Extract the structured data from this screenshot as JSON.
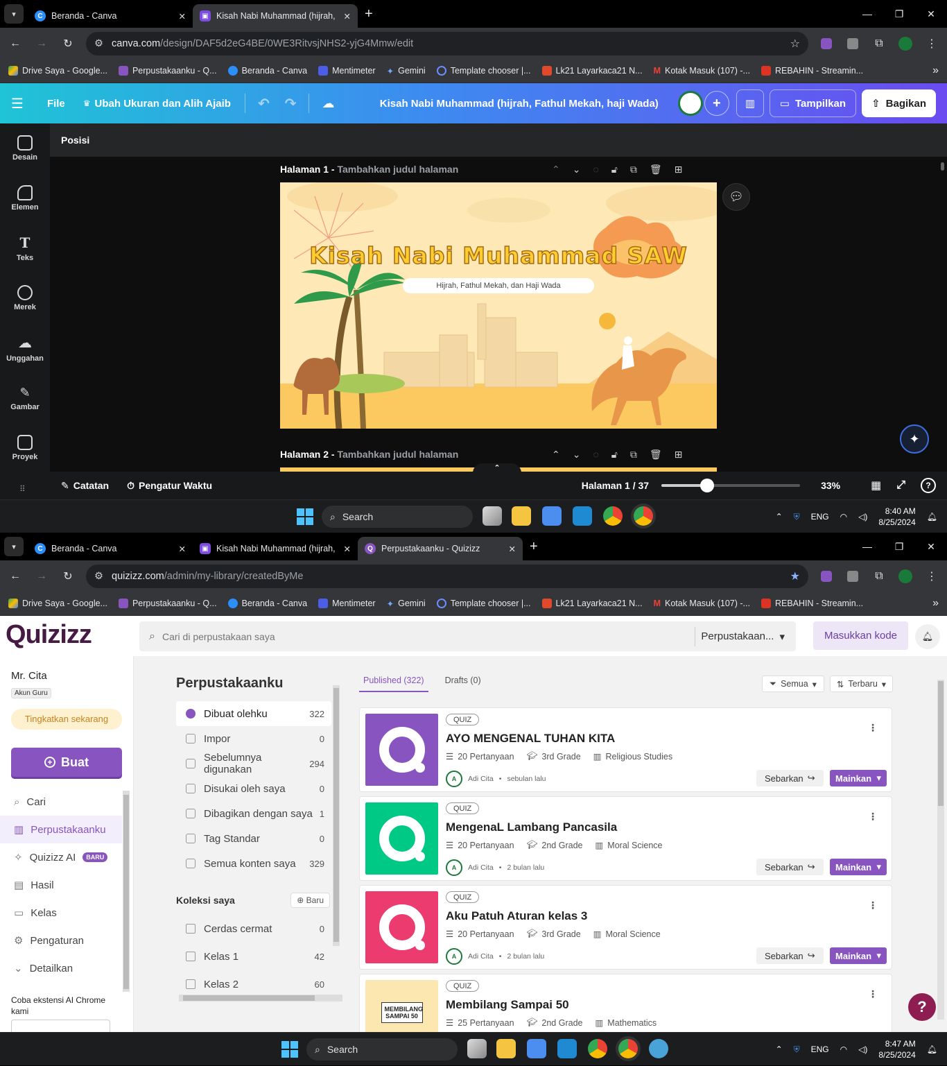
{
  "top": {
    "tabs": [
      {
        "title": "Beranda - Canva",
        "favicon": "canva-icon",
        "color": "#2c8ef8"
      },
      {
        "title": "Kisah Nabi Muhammad (hijrah,",
        "favicon": "canva-doc-icon",
        "color": "#7d4ce0"
      }
    ],
    "url_domain": "canva.com",
    "url_path": "/design/DAF5d2eG4BE/0WE3RitvsjNHS2-yjG4Mmw/edit",
    "bookmarks": [
      "Drive Saya - Google...",
      "Perpustakaanku - Q...",
      "Beranda - Canva",
      "Mentimeter",
      "Gemini",
      "Template chooser |...",
      "Lk21 Layarkaca21 N...",
      "Kotak Masuk (107) -...",
      "REBAHIN - Streamin..."
    ]
  },
  "canva": {
    "menu_file": "File",
    "menu_resize": "Ubah Ukuran dan Alih Ajaib",
    "doc_title": "Kisah Nabi Muhammad (hijrah, Fathul Mekah, haji Wada)",
    "btn_present": "Tampilkan",
    "btn_share": "Bagikan",
    "sidebar": [
      "Desain",
      "Elemen",
      "Teks",
      "Merek",
      "Unggahan",
      "Gambar",
      "Proyek"
    ],
    "position_label": "Posisi",
    "page1_label": "Halaman 1 -",
    "page1_sub": "Tambahkan judul halaman",
    "page2_label": "Halaman 2 -",
    "page2_sub": "Tambahkan judul halaman",
    "slide_title": "Kisah Nabi Muhammad SAW",
    "slide_subtitle": "Hijrah, Fathul Mekah, dan Haji Wada",
    "notes": "Catatan",
    "timer": "Pengatur Waktu",
    "page_count": "Halaman 1 / 37",
    "zoom": "33%",
    "zoom_level": 0.33
  },
  "taskbar1": {
    "search": "Search",
    "lang": "ENG",
    "time": "8:40 AM",
    "date": "8/25/2024"
  },
  "bottom": {
    "tabs": [
      {
        "title": "Beranda - Canva"
      },
      {
        "title": "Kisah Nabi Muhammad (hijrah,"
      },
      {
        "title": "Perpustakaanku - Quizizz"
      }
    ],
    "url_domain": "quizizz.com",
    "url_path": "/admin/my-library/createdByMe"
  },
  "quizizz": {
    "logo": "Quizizz",
    "search_placeholder": "Cari di perpustakaan saya",
    "scope": "Perpustakaan...",
    "enter_code": "Masukkan kode",
    "user_name": "Mr. Cita",
    "user_role": "Akun Guru",
    "upgrade": "Tingkatkan sekarang",
    "create": "Buat",
    "nav": [
      "Cari",
      "Perpustakaanku",
      "Quizizz AI",
      "Hasil",
      "Kelas",
      "Pengaturan",
      "Detailkan"
    ],
    "ai_badge": "BARU",
    "chrome_ext": "Coba ekstensi AI Chrome kami",
    "library_title": "Perpustakaanku",
    "library_nav": [
      {
        "label": "Dibuat olehku",
        "count": "322"
      },
      {
        "label": "Impor",
        "count": "0"
      },
      {
        "label": "Sebelumnya digunakan",
        "count": "294"
      },
      {
        "label": "Disukai oleh saya",
        "count": "0"
      },
      {
        "label": "Dibagikan dengan saya",
        "count": "1"
      },
      {
        "label": "Tag Standar",
        "count": "0"
      },
      {
        "label": "Semua konten saya",
        "count": "329"
      }
    ],
    "collections_title": "Koleksi saya",
    "new_collection": "Baru",
    "collections": [
      {
        "label": "Cerdas cermat",
        "count": "0"
      },
      {
        "label": "Kelas 1",
        "count": "42"
      },
      {
        "label": "Kelas 2",
        "count": "60"
      }
    ],
    "tab_published": "Published (322)",
    "tab_drafts": "Drafts (0)",
    "filter_all": "Semua",
    "sort_latest": "Terbaru",
    "share_label": "Sebarkan",
    "play_label": "Mainkan",
    "badge": "QUIZ",
    "quizzes": [
      {
        "title": "AYO MENGENAL TUHAN KITA",
        "questions": "20 Pertanyaan",
        "grade": "3rd Grade",
        "subject": "Religious Studies",
        "author": "Adi Cita",
        "when": "sebulan lalu",
        "color": "#8854c0"
      },
      {
        "title": "MengenaL Lambang Pancasila",
        "questions": "20 Pertanyaan",
        "grade": "2nd Grade",
        "subject": "Moral Science",
        "author": "Adi Cita",
        "when": "2 bulan lalu",
        "color": "#00c985"
      },
      {
        "title": "Aku Patuh Aturan kelas 3",
        "questions": "20 Pertanyaan",
        "grade": "3rd Grade",
        "subject": "Moral Science",
        "author": "Adi Cita",
        "when": "2 bulan lalu",
        "color": "#ec3b6e"
      },
      {
        "title": "Membilang Sampai 50",
        "questions": "25 Pertanyaan",
        "grade": "2nd Grade",
        "subject": "Mathematics",
        "author": "",
        "when": "",
        "color": "#fde7b0",
        "thumb_text": "MEMBILANG SAMPAI 50"
      }
    ]
  },
  "taskbar2": {
    "search": "Search",
    "lang": "ENG",
    "time": "8:47 AM",
    "date": "8/25/2024"
  }
}
